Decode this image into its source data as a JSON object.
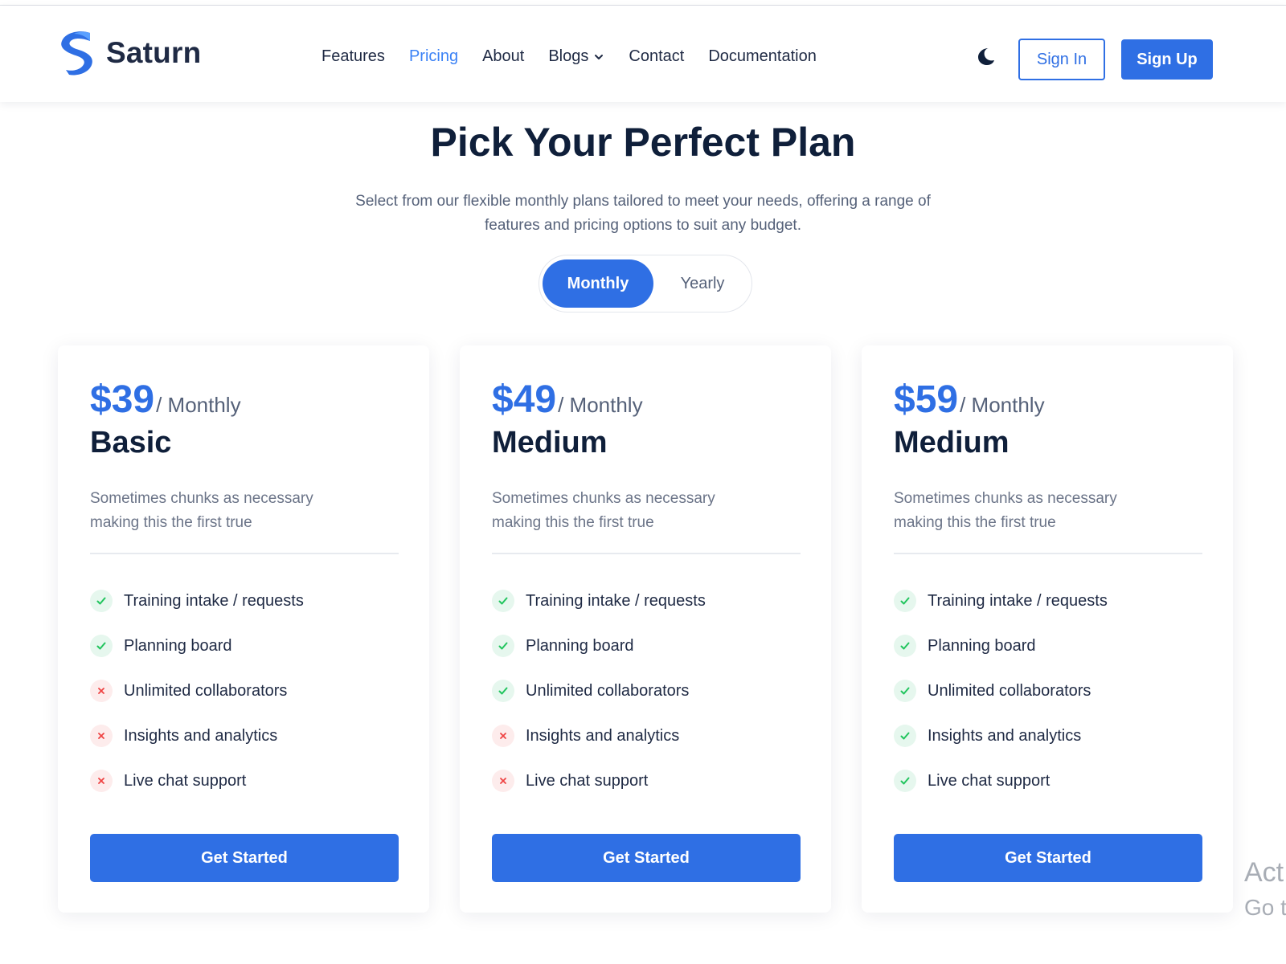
{
  "brand": {
    "name": "Saturn",
    "accent_color": "#2f6fe4",
    "logo_icon": "saturn-s-logo"
  },
  "nav": {
    "links": [
      {
        "label": "Features",
        "active": false
      },
      {
        "label": "Pricing",
        "active": true
      },
      {
        "label": "About",
        "active": false
      },
      {
        "label": "Blogs",
        "active": false,
        "dropdown": true
      },
      {
        "label": "Contact",
        "active": false
      },
      {
        "label": "Documentation",
        "active": false
      }
    ],
    "theme_toggle_icon": "moon-icon",
    "sign_in": "Sign In",
    "sign_up": "Sign Up"
  },
  "hero": {
    "title": "Pick Your Perfect Plan",
    "subtitle": "Select from our flexible monthly plans tailored to meet your needs, offering a range of features and pricing options to suit any budget."
  },
  "billing_toggle": {
    "monthly": "Monthly",
    "yearly": "Yearly",
    "selected": "Monthly"
  },
  "plans": [
    {
      "price": "$39",
      "period": "/ Monthly",
      "name": "Basic",
      "description": "Sometimes chunks as necessary making this the first true",
      "features": [
        {
          "label": "Training intake / requests",
          "included": true
        },
        {
          "label": "Planning board",
          "included": true
        },
        {
          "label": "Unlimited collaborators",
          "included": false
        },
        {
          "label": "Insights and analytics",
          "included": false
        },
        {
          "label": "Live chat support",
          "included": false
        }
      ],
      "cta": "Get Started"
    },
    {
      "price": "$49",
      "period": "/ Monthly",
      "name": "Medium",
      "description": "Sometimes chunks as necessary making this the first true",
      "features": [
        {
          "label": "Training intake / requests",
          "included": true
        },
        {
          "label": "Planning board",
          "included": true
        },
        {
          "label": "Unlimited collaborators",
          "included": true
        },
        {
          "label": "Insights and analytics",
          "included": false
        },
        {
          "label": "Live chat support",
          "included": false
        }
      ],
      "cta": "Get Started"
    },
    {
      "price": "$59",
      "period": "/ Monthly",
      "name": "Medium",
      "description": "Sometimes chunks as necessary making this the first true",
      "features": [
        {
          "label": "Training intake / requests",
          "included": true
        },
        {
          "label": "Planning board",
          "included": true
        },
        {
          "label": "Unlimited collaborators",
          "included": true
        },
        {
          "label": "Insights and analytics",
          "included": true
        },
        {
          "label": "Live chat support",
          "included": true
        }
      ],
      "cta": "Get Started"
    }
  ],
  "colors": {
    "check": "#22c55e",
    "cross": "#ef4444",
    "heading": "#0f1f3a"
  },
  "watermark": {
    "line1": "Act",
    "line2": "Go t"
  }
}
